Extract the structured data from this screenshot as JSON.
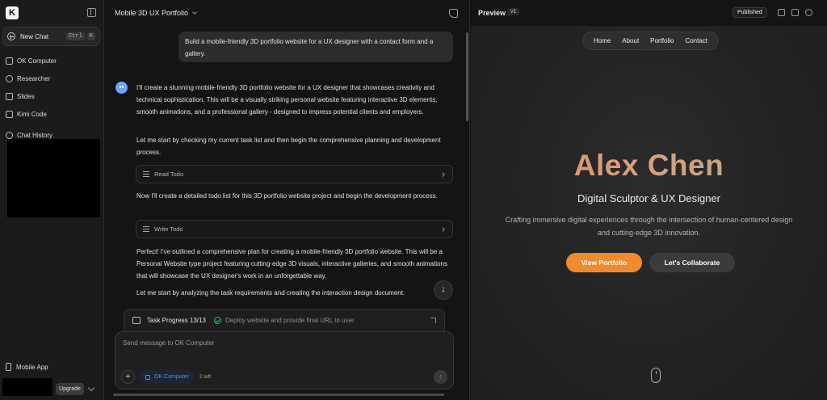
{
  "sidebar": {
    "logo_letter": "K",
    "new_chat": {
      "label": "New Chat",
      "shortcut": [
        "Ctrl",
        "K"
      ]
    },
    "items": [
      {
        "label": "OK Computer",
        "icon": "computer-icon"
      },
      {
        "label": "Researcher",
        "icon": "research-icon"
      },
      {
        "label": "Slides",
        "icon": "slides-icon"
      },
      {
        "label": "Kimi Code",
        "icon": "code-icon"
      },
      {
        "label": "Chat History",
        "icon": "history-icon"
      }
    ],
    "mobile_app": "Mobile App",
    "upgrade_label": "Upgrade"
  },
  "chat": {
    "title": "Mobile 3D UX Portfolio",
    "user_message": "Build a mobile-friendly 3D portfolio website for a UX designer with a contact form and a gallery.",
    "assistant": {
      "p1": "I'll create a stunning mobile-friendly 3D portfolio website for a UX designer that showcases creativity and technical sophistication. This will be a visually striking personal website featuring interactive 3D elements, smooth animations, and a professional gallery - designed to impress potential clients and employers.",
      "p2": "Let me start by checking my current task list and then begin the comprehensive planning and development process.",
      "tool1": "Read Todo",
      "p3": "Now I'll create a detailed todo list for this 3D portfolio website project and begin the development process.",
      "tool2": "Write Todo",
      "p4": "Perfect! I've outlined a comprehensive plan for creating a mobile-friendly 3D portfolio website. This will be a Personal Website type project featuring cutting-edge 3D visuals, interactive galleries, and smooth animations that will showcase the UX designer's work in an unforgettable way.",
      "p5": "Let me start by analyzing the task requirements and creating the interaction design document."
    },
    "task_progress": {
      "label": "Task Progress 13/13",
      "status": "Deploy website and provide final URL to user"
    },
    "input": {
      "placeholder": "Send message to OK Computer",
      "agent": "OK Computer",
      "remaining": "2 left"
    }
  },
  "preview": {
    "label": "Preview",
    "version": "v1",
    "published": "Published",
    "site": {
      "nav": [
        "Home",
        "About",
        "Portfolio",
        "Contact"
      ],
      "name": "Alex Chen",
      "title": "Digital Sculptor & UX Designer",
      "description": "Crafting immersive digital experiences through the intersection of human-centered design and cutting-edge 3D innovation.",
      "primary_cta": "View Portfolio",
      "secondary_cta": "Let's Collaborate"
    }
  },
  "colors": {
    "accent_orange": "#f08a2c",
    "name_gradient_start": "#e0896a",
    "name_gradient_end": "#a9a98a",
    "check_green": "#38b26a"
  }
}
